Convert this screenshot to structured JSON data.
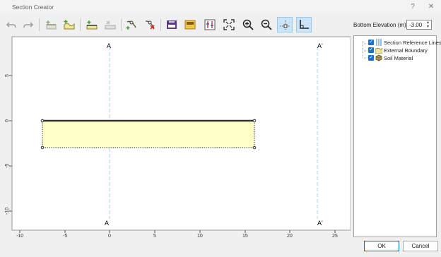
{
  "window": {
    "title": "Section Creator",
    "help_glyph": "?",
    "close_glyph": "✕"
  },
  "toolbar": {
    "icons": [
      "undo-icon",
      "redo-icon",
      "add-layer-icon",
      "add-boundary-icon",
      "insert-line-icon",
      "delete-line-icon",
      "add-vertex-icon",
      "delete-vertex-icon",
      "import-image-icon",
      "import-file-icon",
      "properties-icon",
      "zoom-extents-icon",
      "zoom-in-icon",
      "zoom-out-icon",
      "snap-grid-icon",
      "snap-ortho-icon"
    ],
    "active": [
      "snap-grid-icon",
      "snap-ortho-icon"
    ]
  },
  "elevation": {
    "label": "Bottom Elevation (m):",
    "value": "-3.00",
    "up": "▲",
    "down": "▼"
  },
  "canvas": {
    "x_ticks": [
      "-10",
      "-5",
      "0",
      "5",
      "10",
      "15",
      "20",
      "25"
    ],
    "y_ticks": [
      "5",
      "0",
      "-5",
      "-10"
    ],
    "section_line_a": "A",
    "section_line_a_prime": "A'",
    "colors": {
      "fill": "#ffffc6",
      "ref_line": "#9fd3ee",
      "top_line": "#333333"
    }
  },
  "tree": {
    "items": [
      {
        "label": "Section Reference Lines",
        "icon": "reference-lines-icon"
      },
      {
        "label": "External Boundary",
        "icon": "boundary-icon"
      },
      {
        "label": "Soil Material",
        "icon": "soil-material-icon"
      }
    ]
  },
  "footer": {
    "ok_label": "OK",
    "cancel_label": "Cancel"
  }
}
